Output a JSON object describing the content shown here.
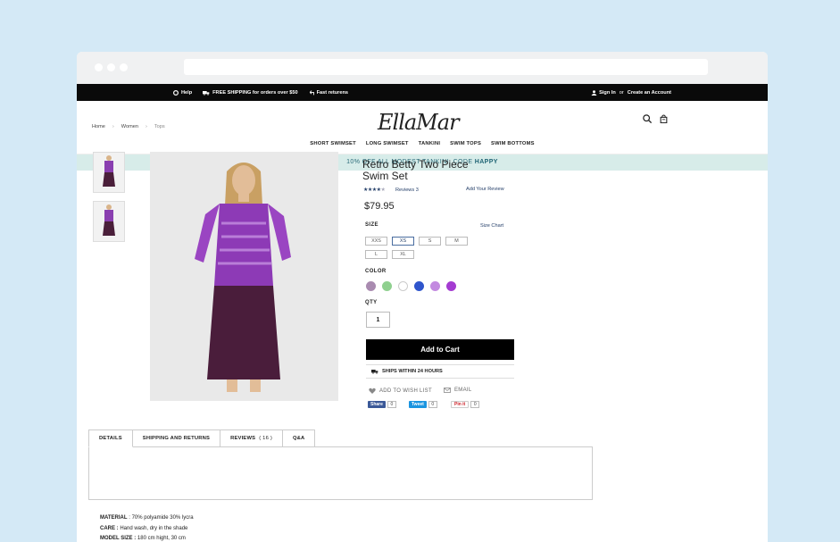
{
  "topbar": {
    "help": "Help",
    "shipping": "FREE SHIPPING for orders over $50",
    "returns": "Fast returens",
    "sign_in": "Sign In",
    "or": "or",
    "create_account": "Create an Account"
  },
  "header": {
    "logo": "EllaMar",
    "nav": [
      "SHORT SWIMSET",
      "LONG SWIMSET",
      "TANKINI",
      "SWIM TOPS",
      "SWIM BOTTOMS"
    ]
  },
  "promo": {
    "text": "10% OFF ALL MODEST TANKINI. CODE ",
    "code": "HAPPY"
  },
  "breadcrumb": [
    "Home",
    "Women",
    "Tops"
  ],
  "product": {
    "title": "Retro Betty Two Piece Swim Set",
    "rating": 4,
    "reviews_label": "Reviews 3",
    "add_review": "Add Your Review",
    "price": "$79.95",
    "size_label": "SIZE",
    "size_chart": "Size Chart",
    "sizes": [
      "XXS",
      "XS",
      "S",
      "M",
      "L",
      "XL"
    ],
    "selected_size": "XS",
    "color_label": "COLOR",
    "colors": [
      "#a98bb0",
      "#8fd08f",
      "#ffffff",
      "#2f55cc",
      "#c38ae0",
      "#a43bd1"
    ],
    "qty_label": "QTY",
    "qty": "1",
    "add_to_cart": "Add to Cart",
    "ships": "SHIPS WITHIN 24 HOURS",
    "wishlist": "ADD TO WISH LIST",
    "email": "EMAIL"
  },
  "share": {
    "facebook": "Share",
    "facebook_count": "0",
    "twitter": "Tweet",
    "twitter_count": "0",
    "pinterest": "Pin it",
    "pinterest_count": "0"
  },
  "tabs": [
    {
      "label": "DETAILS",
      "count": ""
    },
    {
      "label": "SHIPPING AND RETURNS",
      "count": ""
    },
    {
      "label": "REVIEWS",
      "count": "( 16 )"
    },
    {
      "label": "Q&A",
      "count": ""
    }
  ],
  "details": {
    "material_label": "MATERIAL",
    "material": " : 70% polyamide 30% lycra",
    "care_label": "CARE :",
    "care": " Hand wash, dry in the shade",
    "model_label": "MODEL SIZE :",
    "model": " 180 cm hight, 30 cm"
  }
}
